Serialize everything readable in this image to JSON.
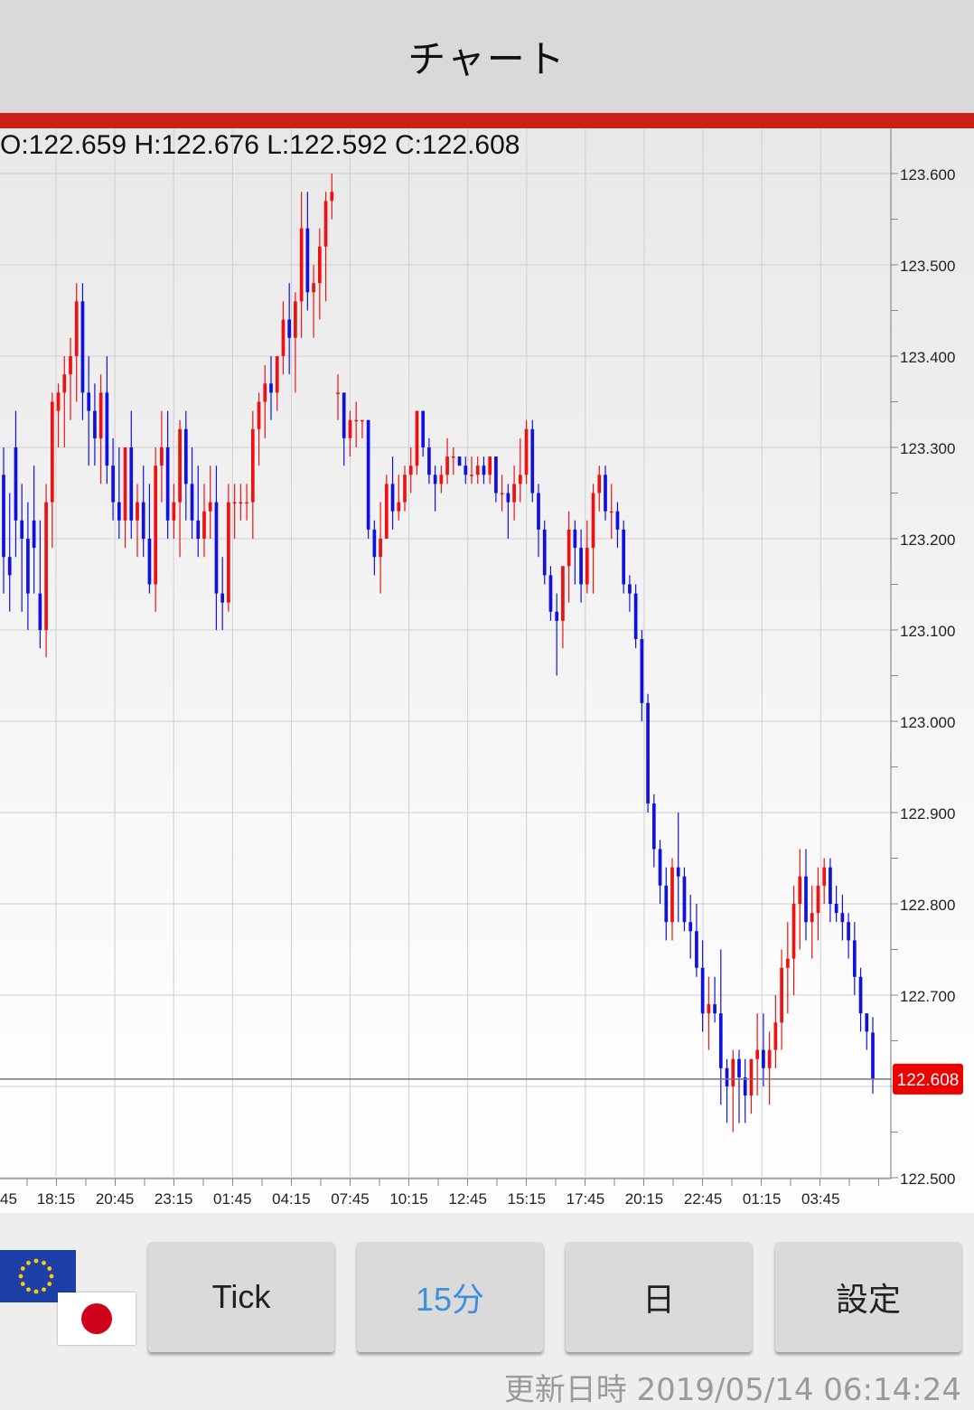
{
  "header": {
    "title": "チャート"
  },
  "ohlc": {
    "text": "O:122.659 H:122.676 L:122.592 C:122.608"
  },
  "price_axis": {
    "labels": [
      "123.600",
      "123.500",
      "123.400",
      "123.300",
      "123.200",
      "123.100",
      "123.000",
      "122.900",
      "122.800",
      "122.700",
      "122.500"
    ],
    "values": [
      123.6,
      123.5,
      123.4,
      123.3,
      123.2,
      123.1,
      123.0,
      122.9,
      122.8,
      122.7,
      122.5
    ]
  },
  "current_price": {
    "label": "122.608",
    "value": 122.608
  },
  "time_axis": {
    "labels": [
      "45",
      "18:15",
      "20:45",
      "23:15",
      "01:45",
      "04:15",
      "07:45",
      "10:15",
      "12:45",
      "15:15",
      "17:45",
      "20:15",
      "22:45",
      "01:15",
      "03:45"
    ]
  },
  "chart_data": {
    "type": "candlestick",
    "yrange": [
      122.5,
      123.6
    ],
    "colors": {
      "up": "#ee1111",
      "down": "#1111dd"
    },
    "candles": [
      [
        123.27,
        123.3,
        123.14,
        123.18
      ],
      [
        123.18,
        123.25,
        123.12,
        123.16
      ],
      [
        123.3,
        123.34,
        123.18,
        123.22
      ],
      [
        123.22,
        123.26,
        123.12,
        123.2
      ],
      [
        123.2,
        123.24,
        123.1,
        123.14
      ],
      [
        123.22,
        123.28,
        123.14,
        123.19
      ],
      [
        123.14,
        123.22,
        123.08,
        123.1
      ],
      [
        123.1,
        123.26,
        123.07,
        123.24
      ],
      [
        123.24,
        123.36,
        123.19,
        123.35
      ],
      [
        123.34,
        123.37,
        123.3,
        123.36
      ],
      [
        123.36,
        123.4,
        123.3,
        123.38
      ],
      [
        123.38,
        123.42,
        123.33,
        123.4
      ],
      [
        123.4,
        123.48,
        123.35,
        123.46
      ],
      [
        123.46,
        123.48,
        123.33,
        123.36
      ],
      [
        123.36,
        123.4,
        123.28,
        123.34
      ],
      [
        123.34,
        123.37,
        123.28,
        123.31
      ],
      [
        123.31,
        123.38,
        123.26,
        123.36
      ],
      [
        123.36,
        123.4,
        123.26,
        123.28
      ],
      [
        123.28,
        123.31,
        123.22,
        123.24
      ],
      [
        123.24,
        123.3,
        123.2,
        123.22
      ],
      [
        123.22,
        123.26,
        123.19,
        123.3
      ],
      [
        123.3,
        123.34,
        123.2,
        123.22
      ],
      [
        123.22,
        123.26,
        123.18,
        123.24
      ],
      [
        123.24,
        123.28,
        123.18,
        123.2
      ],
      [
        123.2,
        123.26,
        123.14,
        123.15
      ],
      [
        123.15,
        123.3,
        123.12,
        123.28
      ],
      [
        123.28,
        123.34,
        123.24,
        123.3
      ],
      [
        123.3,
        123.34,
        123.2,
        123.22
      ],
      [
        123.22,
        123.26,
        123.2,
        123.24
      ],
      [
        123.24,
        123.33,
        123.18,
        123.32
      ],
      [
        123.32,
        123.34,
        123.22,
        123.26
      ],
      [
        123.26,
        123.3,
        123.2,
        123.22
      ],
      [
        123.22,
        123.28,
        123.18,
        123.2
      ],
      [
        123.2,
        123.26,
        123.18,
        123.23
      ],
      [
        123.23,
        123.28,
        123.2,
        123.24
      ],
      [
        123.24,
        123.28,
        123.1,
        123.14
      ],
      [
        123.14,
        123.18,
        123.1,
        123.13
      ],
      [
        123.13,
        123.26,
        123.12,
        123.24
      ],
      [
        123.24,
        123.26,
        123.2,
        123.24
      ],
      [
        123.24,
        123.26,
        123.22,
        123.24
      ],
      [
        123.24,
        123.26,
        123.22,
        123.24
      ],
      [
        123.24,
        123.34,
        123.2,
        123.32
      ],
      [
        123.32,
        123.36,
        123.28,
        123.35
      ],
      [
        123.35,
        123.39,
        123.31,
        123.37
      ],
      [
        123.37,
        123.4,
        123.33,
        123.36
      ],
      [
        123.36,
        123.38,
        123.34,
        123.4
      ],
      [
        123.4,
        123.46,
        123.38,
        123.44
      ],
      [
        123.44,
        123.48,
        123.38,
        123.42
      ],
      [
        123.42,
        123.47,
        123.36,
        123.46
      ],
      [
        123.46,
        123.58,
        123.42,
        123.54
      ],
      [
        123.54,
        123.58,
        123.45,
        123.47
      ],
      [
        123.47,
        123.5,
        123.42,
        123.48
      ],
      [
        123.48,
        123.54,
        123.44,
        123.52
      ],
      [
        123.52,
        123.58,
        123.46,
        123.57
      ],
      [
        123.57,
        123.6,
        123.55,
        123.58
      ],
      [
        123.36,
        123.38,
        123.33,
        123.36
      ],
      [
        123.36,
        123.36,
        123.28,
        123.31
      ],
      [
        123.31,
        123.34,
        123.29,
        123.33
      ],
      [
        123.33,
        123.35,
        123.3,
        123.33
      ],
      [
        123.33,
        123.33,
        123.31,
        123.33
      ],
      [
        123.33,
        123.33,
        123.2,
        123.21
      ],
      [
        123.21,
        123.22,
        123.16,
        123.18
      ],
      [
        123.18,
        123.24,
        123.14,
        123.2
      ],
      [
        123.2,
        123.27,
        123.2,
        123.26
      ],
      [
        123.26,
        123.29,
        123.21,
        123.23
      ],
      [
        123.23,
        123.27,
        123.22,
        123.24
      ],
      [
        123.24,
        123.28,
        123.23,
        123.27
      ],
      [
        123.27,
        123.3,
        123.25,
        123.28
      ],
      [
        123.28,
        123.34,
        123.27,
        123.34
      ],
      [
        123.34,
        123.34,
        123.29,
        123.3
      ],
      [
        123.3,
        123.31,
        123.26,
        123.27
      ],
      [
        123.27,
        123.28,
        123.23,
        123.26
      ],
      [
        123.26,
        123.28,
        123.25,
        123.27
      ],
      [
        123.27,
        123.31,
        123.26,
        123.29
      ],
      [
        123.29,
        123.3,
        123.27,
        123.29
      ],
      [
        123.29,
        123.29,
        123.28,
        123.28
      ],
      [
        123.28,
        123.29,
        123.26,
        123.27
      ],
      [
        123.27,
        123.29,
        123.26,
        123.27
      ],
      [
        123.27,
        123.29,
        123.26,
        123.28
      ],
      [
        123.28,
        123.29,
        123.26,
        123.27
      ],
      [
        123.27,
        123.29,
        123.26,
        123.29
      ],
      [
        123.29,
        123.29,
        123.24,
        123.25
      ],
      [
        123.25,
        123.27,
        123.23,
        123.25
      ],
      [
        123.25,
        123.26,
        123.2,
        123.24
      ],
      [
        123.24,
        123.28,
        123.22,
        123.26
      ],
      [
        123.26,
        123.31,
        123.24,
        123.27
      ],
      [
        123.27,
        123.33,
        123.26,
        123.32
      ],
      [
        123.32,
        123.33,
        123.24,
        123.25
      ],
      [
        123.25,
        123.26,
        123.18,
        123.21
      ],
      [
        123.21,
        123.22,
        123.15,
        123.16
      ],
      [
        123.16,
        123.17,
        123.11,
        123.12
      ],
      [
        123.12,
        123.14,
        123.05,
        123.11
      ],
      [
        123.11,
        123.17,
        123.08,
        123.17
      ],
      [
        123.17,
        123.23,
        123.13,
        123.21
      ],
      [
        123.21,
        123.22,
        123.15,
        123.19
      ],
      [
        123.19,
        123.21,
        123.13,
        123.15
      ],
      [
        123.15,
        123.22,
        123.14,
        123.19
      ],
      [
        123.19,
        123.26,
        123.14,
        123.25
      ],
      [
        123.25,
        123.28,
        123.23,
        123.27
      ],
      [
        123.27,
        123.28,
        123.22,
        123.23
      ],
      [
        123.23,
        123.26,
        123.2,
        123.23
      ],
      [
        123.23,
        123.24,
        123.19,
        123.21
      ],
      [
        123.21,
        123.22,
        123.14,
        123.15
      ],
      [
        123.15,
        123.16,
        123.12,
        123.14
      ],
      [
        123.14,
        123.15,
        123.08,
        123.09
      ],
      [
        123.09,
        123.1,
        123.0,
        123.02
      ],
      [
        123.02,
        123.03,
        122.9,
        122.91
      ],
      [
        122.91,
        122.92,
        122.84,
        122.86
      ],
      [
        122.86,
        122.87,
        122.8,
        122.82
      ],
      [
        122.82,
        122.84,
        122.76,
        122.78
      ],
      [
        122.78,
        122.85,
        122.76,
        122.84
      ],
      [
        122.84,
        122.9,
        122.78,
        122.83
      ],
      [
        122.83,
        122.84,
        122.77,
        122.78
      ],
      [
        122.78,
        122.81,
        122.74,
        122.77
      ],
      [
        122.77,
        122.8,
        122.72,
        122.73
      ],
      [
        122.73,
        122.76,
        122.66,
        122.68
      ],
      [
        122.68,
        122.72,
        122.64,
        122.69
      ],
      [
        122.69,
        122.72,
        122.67,
        122.68
      ],
      [
        122.68,
        122.75,
        122.58,
        122.62
      ],
      [
        122.62,
        122.63,
        122.56,
        122.6
      ],
      [
        122.6,
        122.64,
        122.55,
        122.63
      ],
      [
        122.63,
        122.64,
        122.56,
        122.61
      ],
      [
        122.61,
        122.63,
        122.56,
        122.59
      ],
      [
        122.59,
        122.63,
        122.57,
        122.63
      ],
      [
        122.63,
        122.68,
        122.59,
        122.64
      ],
      [
        122.64,
        122.68,
        122.6,
        122.62
      ],
      [
        122.62,
        122.66,
        122.58,
        122.64
      ],
      [
        122.64,
        122.7,
        122.62,
        122.67
      ],
      [
        122.67,
        122.75,
        122.64,
        122.73
      ],
      [
        122.73,
        122.78,
        122.68,
        122.74
      ],
      [
        122.74,
        122.82,
        122.7,
        122.8
      ],
      [
        122.8,
        122.86,
        122.75,
        122.83
      ],
      [
        122.83,
        122.86,
        122.76,
        122.78
      ],
      [
        122.78,
        122.82,
        122.74,
        122.79
      ],
      [
        122.79,
        122.84,
        122.76,
        122.82
      ],
      [
        122.82,
        122.85,
        122.8,
        122.84
      ],
      [
        122.84,
        122.85,
        122.78,
        122.8
      ],
      [
        122.8,
        122.82,
        122.78,
        122.79
      ],
      [
        122.79,
        122.81,
        122.76,
        122.78
      ],
      [
        122.78,
        122.79,
        122.74,
        122.76
      ],
      [
        122.76,
        122.78,
        122.7,
        122.72
      ],
      [
        122.72,
        122.73,
        122.66,
        122.68
      ],
      [
        122.68,
        122.68,
        122.64,
        122.66
      ],
      [
        122.659,
        122.676,
        122.592,
        122.608
      ]
    ]
  },
  "buttons": [
    {
      "label": "Tick",
      "active": false
    },
    {
      "label": "15分",
      "active": true
    },
    {
      "label": "日",
      "active": false
    },
    {
      "label": "設定",
      "active": false
    }
  ],
  "update": {
    "label": "更新日時",
    "datetime": "2019/05/14 06:14:24"
  },
  "currency_pair": {
    "base_flag": "eu-flag",
    "quote_flag": "jp-flag"
  }
}
